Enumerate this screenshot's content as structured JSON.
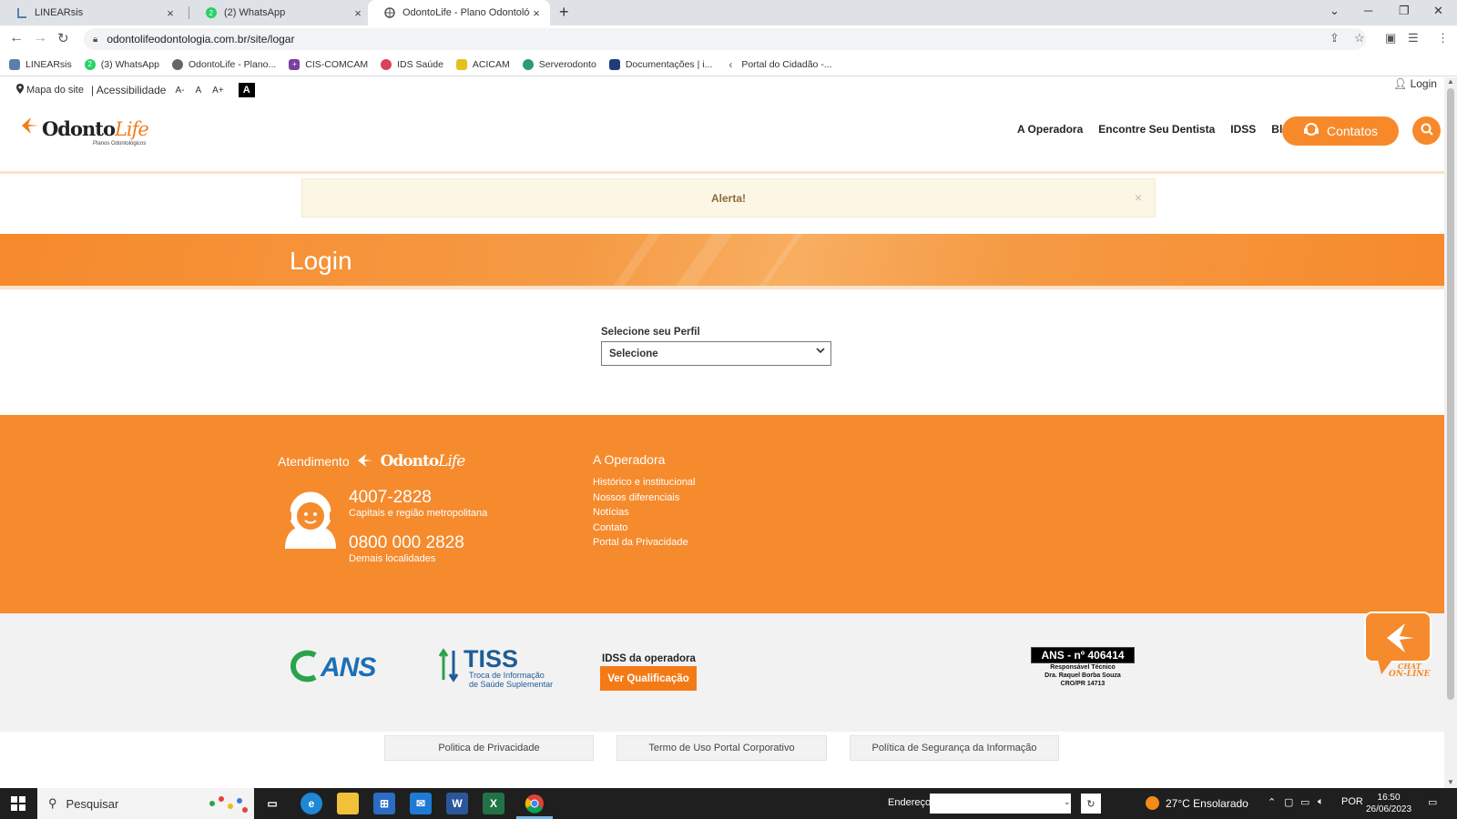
{
  "browser": {
    "tabs": [
      {
        "title": "LINEARsis",
        "active": false
      },
      {
        "title": "(2) WhatsApp",
        "active": false
      },
      {
        "title": "OdontoLife - Plano Odontológico",
        "active": true
      }
    ],
    "url": "odontolifeodontologia.com.br/site/logar",
    "bookmarks": [
      {
        "label": "LINEARsis",
        "icon": "linearsis-icon",
        "color": "#5a7fa8"
      },
      {
        "label": "(3) WhatsApp",
        "icon": "whatsapp-icon",
        "color": "#25d366"
      },
      {
        "label": "OdontoLife - Plano...",
        "icon": "globe-icon",
        "color": "#666666"
      },
      {
        "label": "CIS-COMCAM",
        "icon": "cis-icon",
        "color": "#7a3fa0"
      },
      {
        "label": "IDS Saúde",
        "icon": "ids-icon",
        "color": "#d9435a"
      },
      {
        "label": "ACICAM",
        "icon": "acicam-icon",
        "color": "#e6c01e"
      },
      {
        "label": "Serverodonto",
        "icon": "serverodonto-icon",
        "color": "#2a9a7a"
      },
      {
        "label": "Documentações | i...",
        "icon": "doc-icon",
        "color": "#1f3d7a"
      },
      {
        "label": "Portal do Cidadão -...",
        "icon": "arrow-left-icon",
        "color": "#555555"
      }
    ]
  },
  "page": {
    "access": {
      "sitemap": "Mapa do site",
      "accessibility": "| Acessibilidade",
      "font_minus": "A-",
      "font_normal": "A",
      "font_plus": "A+",
      "contrast": "A"
    },
    "login_link": "Login",
    "logo": {
      "part1": "Odonto",
      "part2": "Life",
      "subtitle": "Planos Odontológicos"
    },
    "nav": [
      "A Operadora",
      "Encontre Seu Dentista",
      "IDSS",
      "Blog"
    ],
    "contatos_label": "Contatos",
    "alert_text": "Alerta!",
    "alert_close": "×",
    "banner_title": "Login",
    "profile_label": "Selecione seu Perfil",
    "profile_selected": "Selecione",
    "footer": {
      "atendimento_label": "Atendimento",
      "phone1": "4007-2828",
      "phone1_sub": "Capitais e região metropolitana",
      "phone2": "0800 000 2828",
      "phone2_sub": "Demais localidades",
      "operadora_title": "A Operadora",
      "operadora_links": [
        "Histórico e institucional",
        "Nossos diferenciais",
        "Notícias",
        "Contato",
        "Portal da Privacidade"
      ],
      "ans_logo_text": "ANS",
      "tiss_title": "TISS",
      "tiss_sub1": "Troca de Informação",
      "tiss_sub2": "de Saúde Suplementar",
      "idss_label": "IDSS da operadora",
      "idss_button": "Ver Qualificação",
      "ans_reg": "ANS - nº 406414",
      "ans_reg_lines": [
        "Responsável Técnico",
        "Dra. Raquel Borba Souza",
        "CRO/PR 14713"
      ],
      "bottom_links": [
        "Politica de Privacidade",
        "Termo de Uso Portal Corporativo",
        "Política de Segurança da Informação"
      ],
      "chat_line1": "CHAT",
      "chat_line2": "ON-LINE"
    },
    "colors": {
      "brand_orange": "#f58b2d",
      "button_orange": "#f47a16"
    }
  },
  "taskbar": {
    "search_placeholder": "Pesquisar",
    "address_label": "Endereço",
    "weather": "27°C  Ensolarado",
    "language": "POR",
    "time": "16:50",
    "date": "26/06/2023",
    "word_letter": "W",
    "excel_letter": "X"
  }
}
